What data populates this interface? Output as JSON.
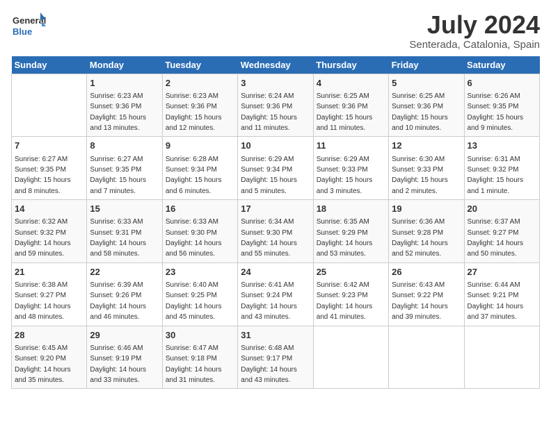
{
  "header": {
    "logo_general": "General",
    "logo_blue": "Blue",
    "month_title": "July 2024",
    "subtitle": "Senterada, Catalonia, Spain"
  },
  "weekdays": [
    "Sunday",
    "Monday",
    "Tuesday",
    "Wednesday",
    "Thursday",
    "Friday",
    "Saturday"
  ],
  "weeks": [
    [
      {
        "day": "",
        "sunrise": "",
        "sunset": "",
        "daylight": ""
      },
      {
        "day": "1",
        "sunrise": "Sunrise: 6:23 AM",
        "sunset": "Sunset: 9:36 PM",
        "daylight": "Daylight: 15 hours and 13 minutes."
      },
      {
        "day": "2",
        "sunrise": "Sunrise: 6:23 AM",
        "sunset": "Sunset: 9:36 PM",
        "daylight": "Daylight: 15 hours and 12 minutes."
      },
      {
        "day": "3",
        "sunrise": "Sunrise: 6:24 AM",
        "sunset": "Sunset: 9:36 PM",
        "daylight": "Daylight: 15 hours and 11 minutes."
      },
      {
        "day": "4",
        "sunrise": "Sunrise: 6:25 AM",
        "sunset": "Sunset: 9:36 PM",
        "daylight": "Daylight: 15 hours and 11 minutes."
      },
      {
        "day": "5",
        "sunrise": "Sunrise: 6:25 AM",
        "sunset": "Sunset: 9:36 PM",
        "daylight": "Daylight: 15 hours and 10 minutes."
      },
      {
        "day": "6",
        "sunrise": "Sunrise: 6:26 AM",
        "sunset": "Sunset: 9:35 PM",
        "daylight": "Daylight: 15 hours and 9 minutes."
      }
    ],
    [
      {
        "day": "7",
        "sunrise": "Sunrise: 6:27 AM",
        "sunset": "Sunset: 9:35 PM",
        "daylight": "Daylight: 15 hours and 8 minutes."
      },
      {
        "day": "8",
        "sunrise": "Sunrise: 6:27 AM",
        "sunset": "Sunset: 9:35 PM",
        "daylight": "Daylight: 15 hours and 7 minutes."
      },
      {
        "day": "9",
        "sunrise": "Sunrise: 6:28 AM",
        "sunset": "Sunset: 9:34 PM",
        "daylight": "Daylight: 15 hours and 6 minutes."
      },
      {
        "day": "10",
        "sunrise": "Sunrise: 6:29 AM",
        "sunset": "Sunset: 9:34 PM",
        "daylight": "Daylight: 15 hours and 5 minutes."
      },
      {
        "day": "11",
        "sunrise": "Sunrise: 6:29 AM",
        "sunset": "Sunset: 9:33 PM",
        "daylight": "Daylight: 15 hours and 3 minutes."
      },
      {
        "day": "12",
        "sunrise": "Sunrise: 6:30 AM",
        "sunset": "Sunset: 9:33 PM",
        "daylight": "Daylight: 15 hours and 2 minutes."
      },
      {
        "day": "13",
        "sunrise": "Sunrise: 6:31 AM",
        "sunset": "Sunset: 9:32 PM",
        "daylight": "Daylight: 15 hours and 1 minute."
      }
    ],
    [
      {
        "day": "14",
        "sunrise": "Sunrise: 6:32 AM",
        "sunset": "Sunset: 9:32 PM",
        "daylight": "Daylight: 14 hours and 59 minutes."
      },
      {
        "day": "15",
        "sunrise": "Sunrise: 6:33 AM",
        "sunset": "Sunset: 9:31 PM",
        "daylight": "Daylight: 14 hours and 58 minutes."
      },
      {
        "day": "16",
        "sunrise": "Sunrise: 6:33 AM",
        "sunset": "Sunset: 9:30 PM",
        "daylight": "Daylight: 14 hours and 56 minutes."
      },
      {
        "day": "17",
        "sunrise": "Sunrise: 6:34 AM",
        "sunset": "Sunset: 9:30 PM",
        "daylight": "Daylight: 14 hours and 55 minutes."
      },
      {
        "day": "18",
        "sunrise": "Sunrise: 6:35 AM",
        "sunset": "Sunset: 9:29 PM",
        "daylight": "Daylight: 14 hours and 53 minutes."
      },
      {
        "day": "19",
        "sunrise": "Sunrise: 6:36 AM",
        "sunset": "Sunset: 9:28 PM",
        "daylight": "Daylight: 14 hours and 52 minutes."
      },
      {
        "day": "20",
        "sunrise": "Sunrise: 6:37 AM",
        "sunset": "Sunset: 9:27 PM",
        "daylight": "Daylight: 14 hours and 50 minutes."
      }
    ],
    [
      {
        "day": "21",
        "sunrise": "Sunrise: 6:38 AM",
        "sunset": "Sunset: 9:27 PM",
        "daylight": "Daylight: 14 hours and 48 minutes."
      },
      {
        "day": "22",
        "sunrise": "Sunrise: 6:39 AM",
        "sunset": "Sunset: 9:26 PM",
        "daylight": "Daylight: 14 hours and 46 minutes."
      },
      {
        "day": "23",
        "sunrise": "Sunrise: 6:40 AM",
        "sunset": "Sunset: 9:25 PM",
        "daylight": "Daylight: 14 hours and 45 minutes."
      },
      {
        "day": "24",
        "sunrise": "Sunrise: 6:41 AM",
        "sunset": "Sunset: 9:24 PM",
        "daylight": "Daylight: 14 hours and 43 minutes."
      },
      {
        "day": "25",
        "sunrise": "Sunrise: 6:42 AM",
        "sunset": "Sunset: 9:23 PM",
        "daylight": "Daylight: 14 hours and 41 minutes."
      },
      {
        "day": "26",
        "sunrise": "Sunrise: 6:43 AM",
        "sunset": "Sunset: 9:22 PM",
        "daylight": "Daylight: 14 hours and 39 minutes."
      },
      {
        "day": "27",
        "sunrise": "Sunrise: 6:44 AM",
        "sunset": "Sunset: 9:21 PM",
        "daylight": "Daylight: 14 hours and 37 minutes."
      }
    ],
    [
      {
        "day": "28",
        "sunrise": "Sunrise: 6:45 AM",
        "sunset": "Sunset: 9:20 PM",
        "daylight": "Daylight: 14 hours and 35 minutes."
      },
      {
        "day": "29",
        "sunrise": "Sunrise: 6:46 AM",
        "sunset": "Sunset: 9:19 PM",
        "daylight": "Daylight: 14 hours and 33 minutes."
      },
      {
        "day": "30",
        "sunrise": "Sunrise: 6:47 AM",
        "sunset": "Sunset: 9:18 PM",
        "daylight": "Daylight: 14 hours and 31 minutes."
      },
      {
        "day": "31",
        "sunrise": "Sunrise: 6:48 AM",
        "sunset": "Sunset: 9:17 PM",
        "daylight": "Daylight: 14 hours and 43 minutes."
      },
      {
        "day": "",
        "sunrise": "",
        "sunset": "",
        "daylight": ""
      },
      {
        "day": "",
        "sunrise": "",
        "sunset": "",
        "daylight": ""
      },
      {
        "day": "",
        "sunrise": "",
        "sunset": "",
        "daylight": ""
      }
    ]
  ]
}
